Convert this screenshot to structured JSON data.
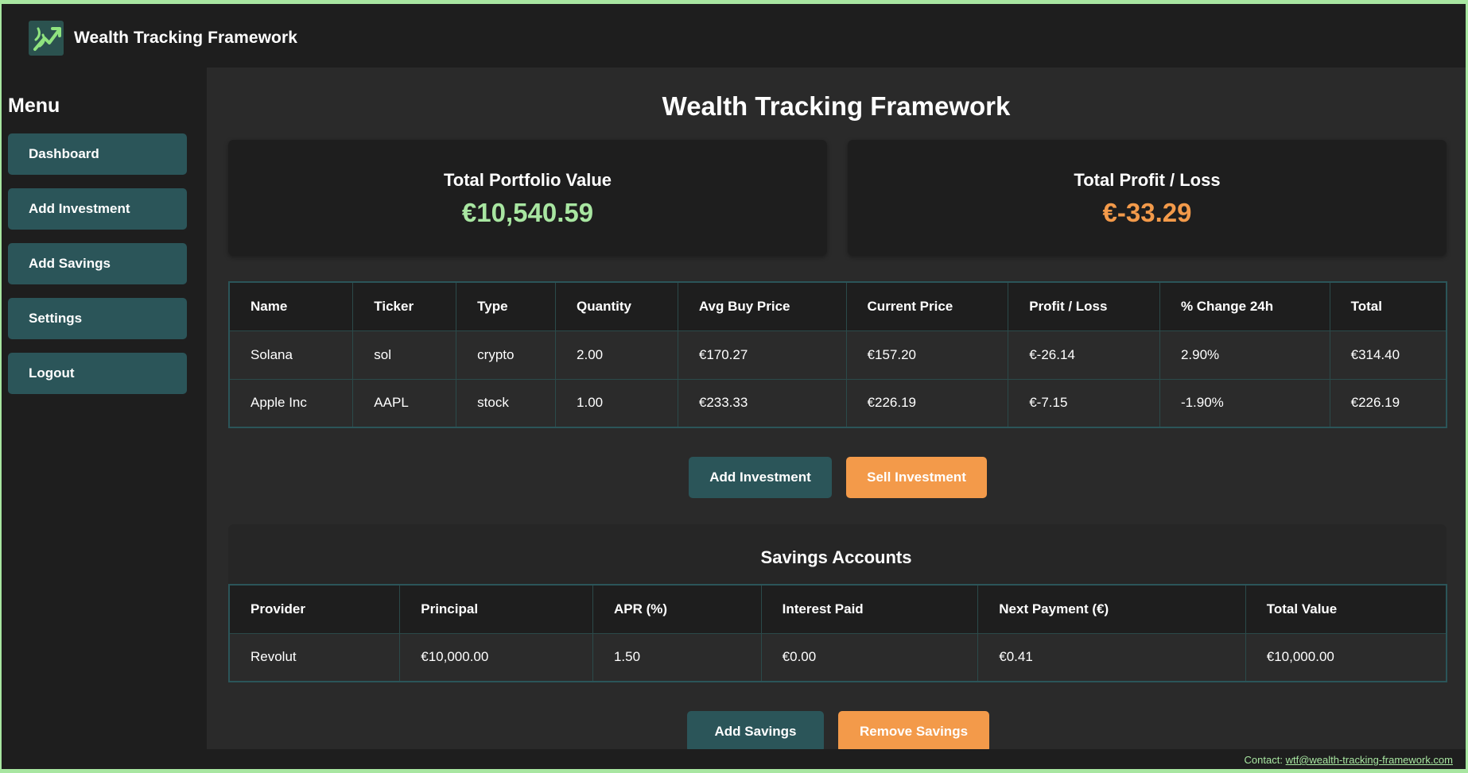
{
  "app": {
    "title": "Wealth Tracking Framework",
    "logo_icon": "growth-arrow-icon"
  },
  "sidebar": {
    "title": "Menu",
    "items": [
      {
        "label": "Dashboard"
      },
      {
        "label": "Add Investment"
      },
      {
        "label": "Add Savings"
      },
      {
        "label": "Settings"
      },
      {
        "label": "Logout"
      }
    ]
  },
  "main": {
    "title": "Wealth Tracking Framework",
    "summary": {
      "portfolio_label": "Total Portfolio Value",
      "portfolio_value": "€10,540.59",
      "portfolio_color": "#a8e6a1",
      "pl_label": "Total Profit / Loss",
      "pl_value": "€-33.29",
      "pl_color": "#f39a4a"
    },
    "investments": {
      "columns": [
        "Name",
        "Ticker",
        "Type",
        "Quantity",
        "Avg Buy Price",
        "Current Price",
        "Profit / Loss",
        "% Change 24h",
        "Total"
      ],
      "rows": [
        [
          "Solana",
          "sol",
          "crypto",
          "2.00",
          "€170.27",
          "€157.20",
          "€-26.14",
          "2.90%",
          "€314.40"
        ],
        [
          "Apple Inc",
          "AAPL",
          "stock",
          "1.00",
          "€233.33",
          "€226.19",
          "€-7.15",
          "-1.90%",
          "€226.19"
        ]
      ],
      "add_button": "Add Investment",
      "sell_button": "Sell Investment"
    },
    "savings": {
      "title": "Savings Accounts",
      "columns": [
        "Provider",
        "Principal",
        "APR (%)",
        "Interest Paid",
        "Next Payment (€)",
        "Total Value"
      ],
      "rows": [
        [
          "Revolut",
          "€10,000.00",
          "1.50",
          "€0.00",
          "€0.41",
          "€10,000.00"
        ]
      ],
      "add_button": "Add Savings",
      "remove_button": "Remove Savings"
    }
  },
  "footer": {
    "prefix": "Contact: ",
    "email": "wtf@wealth-tracking-framework.com"
  },
  "colors": {
    "accent_teal": "#2b5559",
    "accent_orange": "#f39a4a",
    "positive_green": "#a8e6a1"
  }
}
